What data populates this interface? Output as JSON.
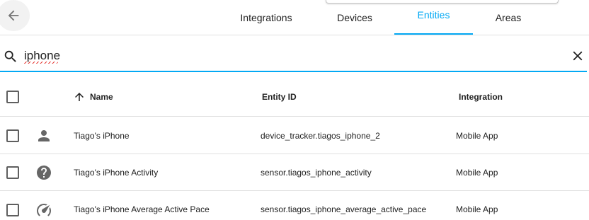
{
  "toolbar": {
    "tabs": [
      {
        "label": "Integrations",
        "active": false
      },
      {
        "label": "Devices",
        "active": false
      },
      {
        "label": "Entities",
        "active": true
      },
      {
        "label": "Areas",
        "active": false
      }
    ],
    "accent_color": "#03a9f4"
  },
  "search": {
    "value": "iphone",
    "icon": "magnify-icon",
    "clear_icon": "close-icon"
  },
  "table": {
    "columns": {
      "name": "Name",
      "entity_id": "Entity ID",
      "integration": "Integration"
    },
    "sort": {
      "column": "name",
      "direction": "ascending"
    },
    "rows": [
      {
        "icon": "account-icon",
        "name": "Tiago's iPhone",
        "entity_id": "device_tracker.tiagos_iphone_2",
        "integration": "Mobile App"
      },
      {
        "icon": "help-circle-icon",
        "name": "Tiago's iPhone Activity",
        "entity_id": "sensor.tiagos_iphone_activity",
        "integration": "Mobile App"
      },
      {
        "icon": "speedometer-icon",
        "name": "Tiago's iPhone Average Active Pace",
        "entity_id": "sensor.tiagos_iphone_average_active_pace",
        "integration": "Mobile App"
      }
    ]
  }
}
